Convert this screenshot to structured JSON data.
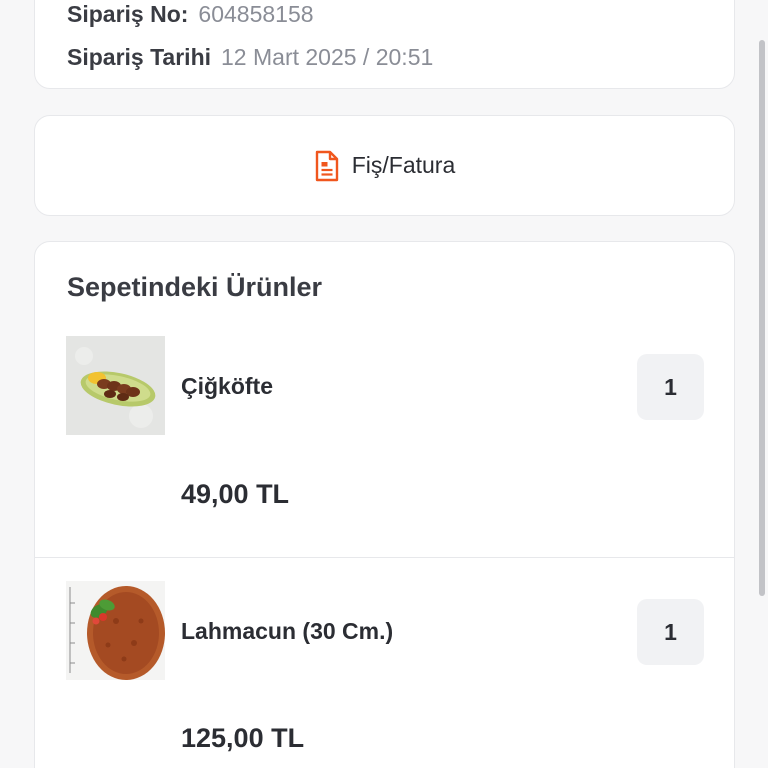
{
  "order": {
    "number_label": "Sipariş No:",
    "number_value": "604858158",
    "date_label": "Sipariş Tarihi",
    "date_value": "12 Mart 2025 / 20:51"
  },
  "receipt": {
    "label": "Fiş/Fatura",
    "icon": "receipt-icon",
    "icon_color": "#f0561d"
  },
  "cart": {
    "title": "Sepetindeki Ürünler",
    "items": [
      {
        "name": "Çiğköfte",
        "quantity": "1",
        "price": "49,00 TL",
        "image": "cigkofte-image"
      },
      {
        "name": "Lahmacun (30 Cm.)",
        "quantity": "1",
        "price": "125,00 TL",
        "image": "lahmacun-image"
      }
    ]
  },
  "colors": {
    "accent": "#f0561d",
    "card_border": "#e7e8eb",
    "badge_bg": "#f1f2f4",
    "muted_text": "#8a8d96"
  }
}
